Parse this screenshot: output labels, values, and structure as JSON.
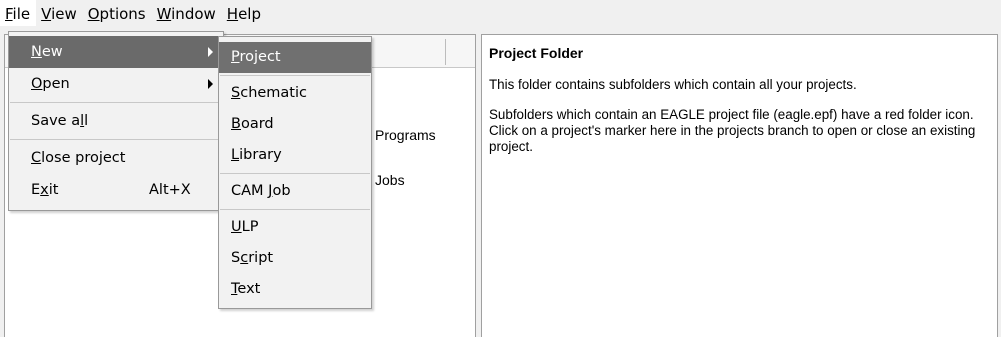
{
  "menubar": {
    "items": [
      {
        "pre": "",
        "acc": "F",
        "post": "ile"
      },
      {
        "pre": "",
        "acc": "V",
        "post": "iew"
      },
      {
        "pre": "",
        "acc": "O",
        "post": "ptions"
      },
      {
        "pre": "",
        "acc": "W",
        "post": "indow"
      },
      {
        "pre": "",
        "acc": "H",
        "post": "elp"
      }
    ]
  },
  "file_menu": {
    "new": {
      "pre": "",
      "acc": "N",
      "post": "ew"
    },
    "open": {
      "pre": "",
      "acc": "O",
      "post": "pen"
    },
    "save_all": {
      "pre": "Save a",
      "acc": "l",
      "post": "l"
    },
    "close_project": {
      "pre": "",
      "acc": "C",
      "post": "lose project"
    },
    "exit": {
      "pre": "E",
      "acc": "x",
      "post": "it",
      "shortcut": "Alt+X"
    }
  },
  "new_menu": {
    "project": {
      "pre": "",
      "acc": "P",
      "post": "roject"
    },
    "schematic": {
      "pre": "",
      "acc": "S",
      "post": "chematic"
    },
    "board": {
      "pre": "",
      "acc": "B",
      "post": "oard"
    },
    "library": {
      "pre": "",
      "acc": "L",
      "post": "ibrary"
    },
    "cam_job": {
      "pre": "CAM ",
      "acc": "J",
      "post": "ob"
    },
    "ulp": {
      "pre": "",
      "acc": "U",
      "post": "LP"
    },
    "script": {
      "pre": "S",
      "acc": "c",
      "post": "ript"
    },
    "text": {
      "pre": "",
      "acc": "T",
      "post": "ext"
    }
  },
  "tree": {
    "programs_desc": "Programs",
    "jobs_desc": "Jobs"
  },
  "info": {
    "title": "Project Folder",
    "para1": "This folder contains subfolders which contain all your projects.",
    "para2": "Subfolders which contain an EAGLE project file (eagle.epf) have a red folder icon. Click on a project's marker here in the projects branch to open or close an existing project."
  }
}
